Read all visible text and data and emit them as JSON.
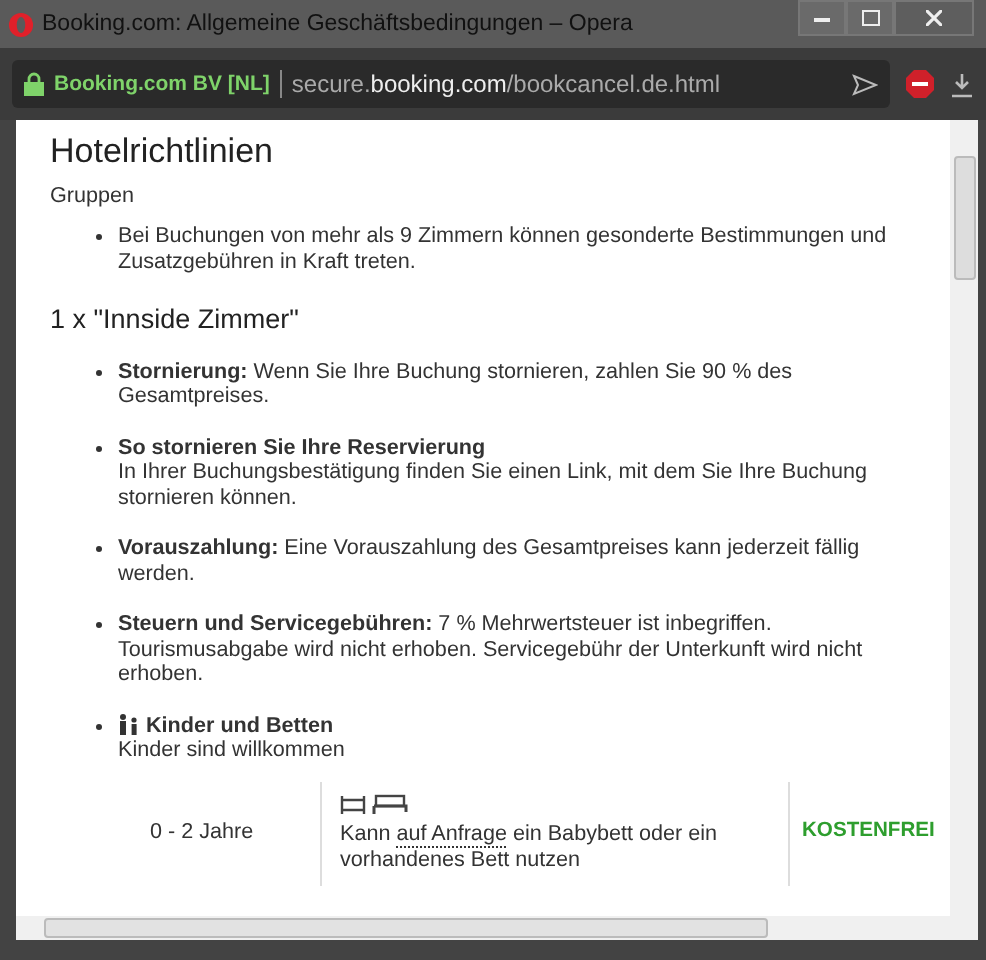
{
  "window": {
    "title": "Booking.com: Allgemeine Geschäftsbedingungen – Opera"
  },
  "address_bar": {
    "identity": "Booking.com BV [NL]",
    "url": "secure.**booking.com**/bookcancel.de.html"
  },
  "content": {
    "heading": "Hotelrichtlinien",
    "section": "Gruppen",
    "group_items": [
      "Bei Buchungen von mehr als 9 Zimmern können gesonderte Bestimmungen und Zusatzgebühren in Kraft treten."
    ],
    "room_title": "1 x \"Innside Zimmer\"",
    "policies": [
      {
        "kind": "inline",
        "text": "**Stornierung:** Wenn Sie Ihre Buchung stornieren, zahlen Sie 90 % des Gesamtpreises."
      },
      {
        "kind": "block",
        "title": "So stornieren Sie Ihre Reservierung",
        "text": "In Ihrer Buchungsbestätigung finden Sie einen Link, mit dem Sie Ihre Buchung stornieren können."
      },
      {
        "kind": "inline",
        "text": "**Vorauszahlung:** Eine Vorauszahlung des Gesamtpreises kann jederzeit fällig werden."
      },
      {
        "kind": "inline",
        "text": "**Steuern und Servicegebühren:** 7 % Mehrwertsteuer ist inbegriffen. Tourismusabgabe wird nicht erhoben. Servicegebühr der Unterkunft wird nicht erhoben."
      },
      {
        "kind": "children",
        "title": "Kinder und Betten",
        "text": "Kinder sind willkommen"
      }
    ],
    "beds_table": [
      {
        "age": "0 - 2 Jahre",
        "before": "Kann ",
        "link": "auf Anfrage",
        "after": " ein Babybett oder ein vorhandenes Bett nutzen",
        "price": "KOSTENFREI"
      }
    ]
  }
}
